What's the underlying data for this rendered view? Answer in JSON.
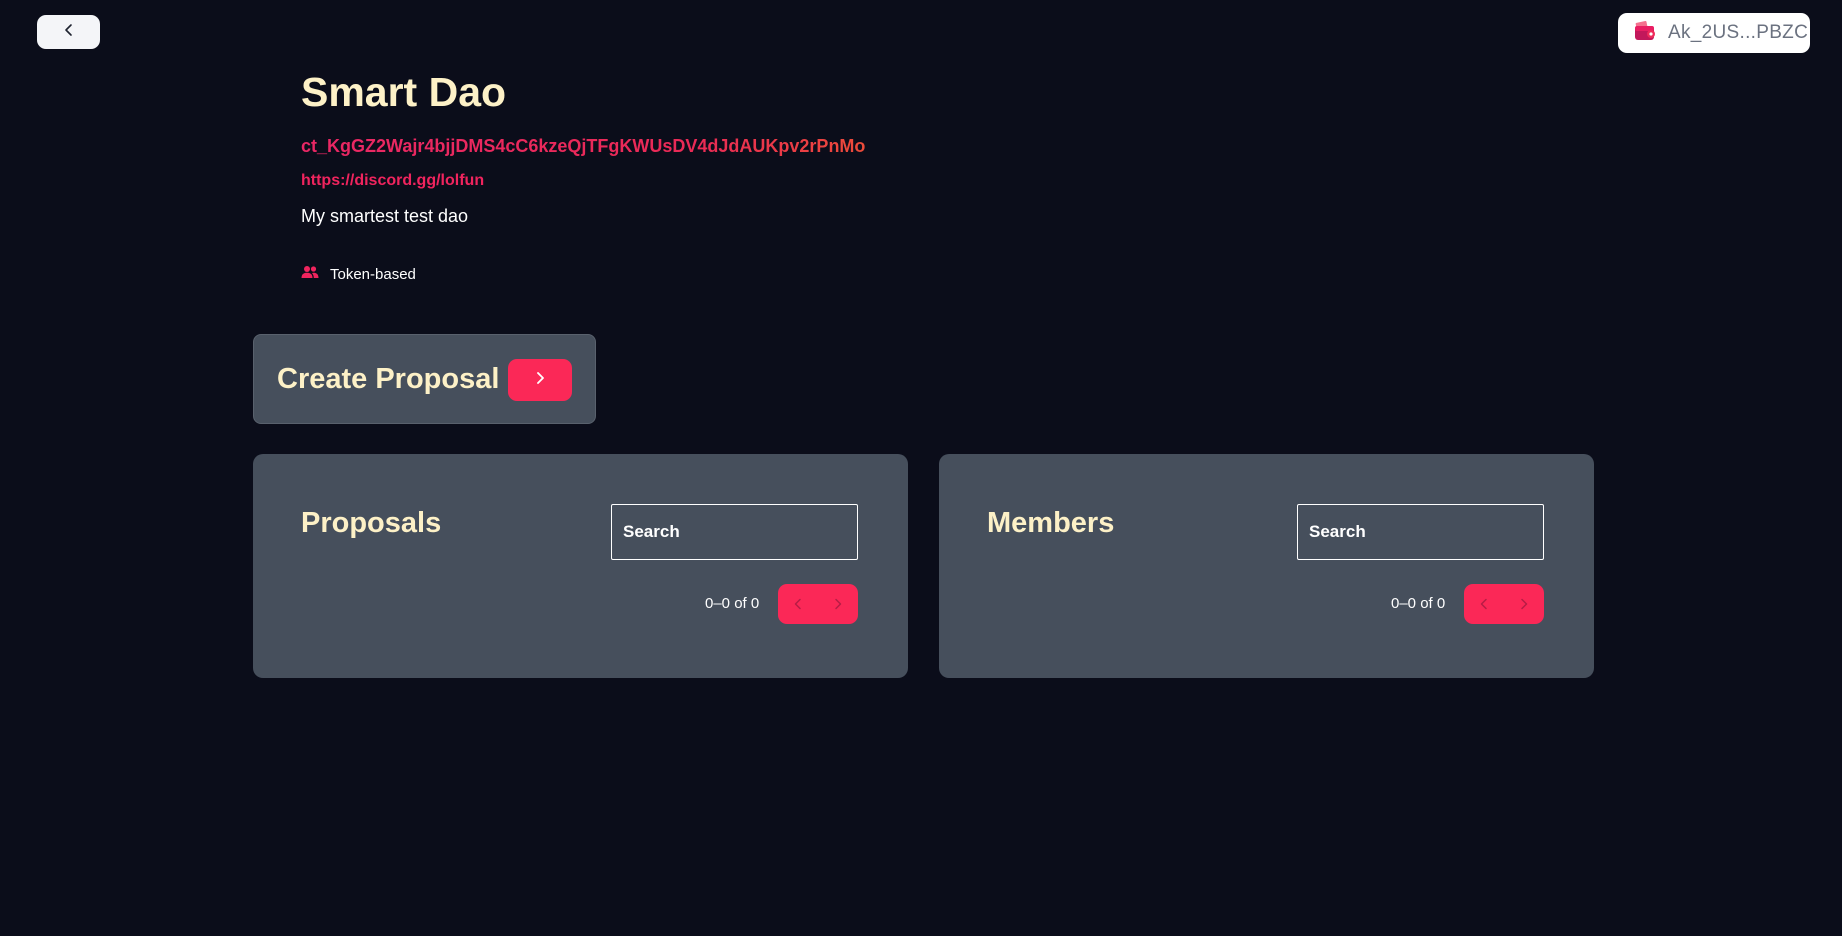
{
  "header": {
    "back_icon": "chevron-left-icon",
    "wallet": {
      "icon": "wallet-icon",
      "address": "Ak_2US...PBZC"
    }
  },
  "dao": {
    "name": "Smart Dao",
    "contract_id": "ct_KgGZ2Wajr4bjjDMS4cC6kzeQjTFgKWUsDV4dJdAUKpv2rPnMo",
    "link": "https://discord.gg/lolfun",
    "description": "My smartest test dao",
    "type_icon": "users-icon",
    "type": "Token-based"
  },
  "create_proposal": {
    "label": "Create Proposal",
    "button_icon": "chevron-right-icon"
  },
  "proposals": {
    "title": "Proposals",
    "search_placeholder": "Search",
    "pagination_text": "0–0 of 0"
  },
  "members": {
    "title": "Members",
    "search_placeholder": "Search",
    "pagination_text": "0–0 of 0"
  },
  "colors": {
    "background": "#0b0d1a",
    "card": "#464f5c",
    "accent": "#fb2857",
    "title": "#fdf1c7"
  }
}
